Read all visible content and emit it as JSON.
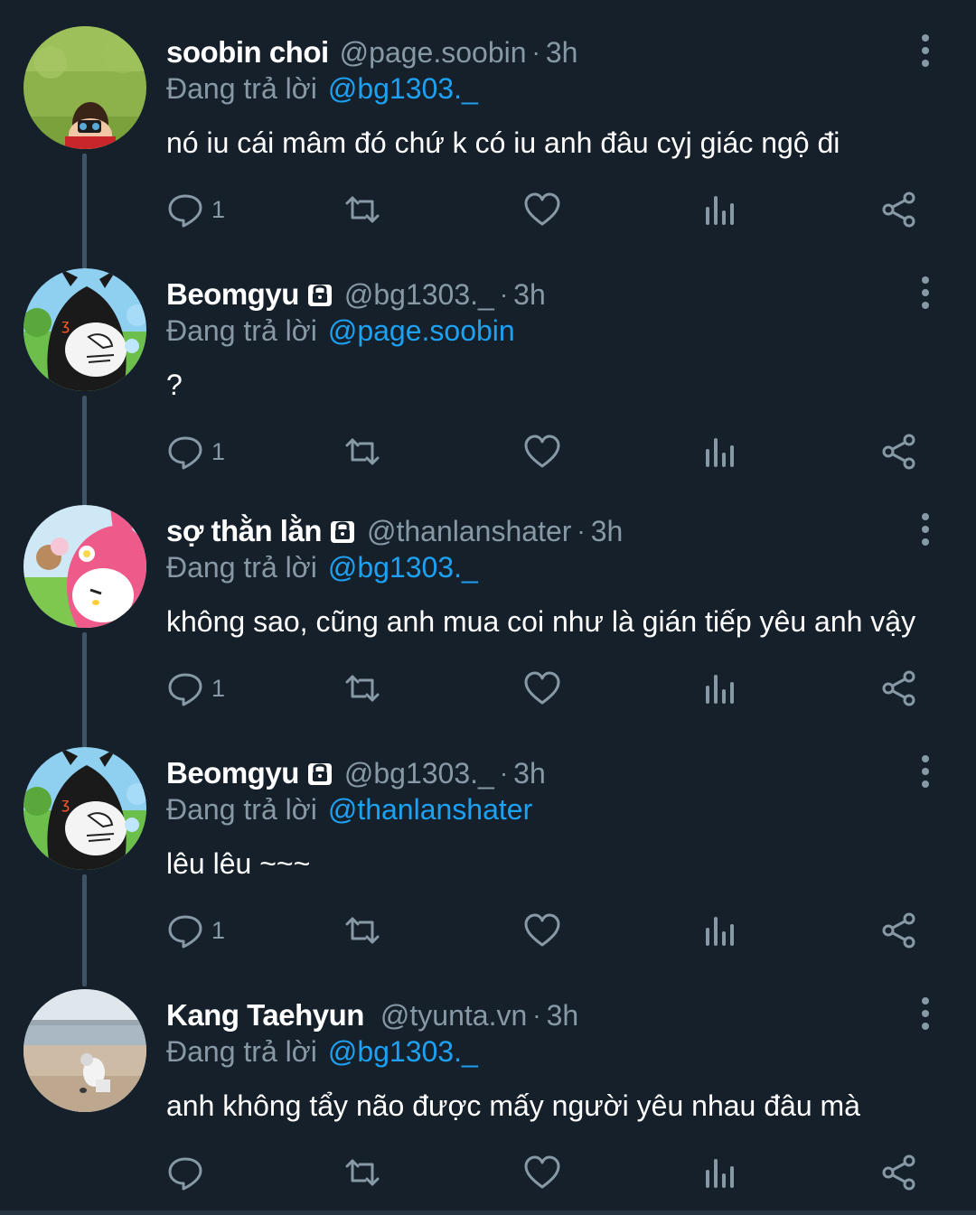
{
  "colors": {
    "background": "#15202b",
    "text": "#ffffff",
    "muted": "#8899a6",
    "link": "#1da1f2",
    "thread_line": "#3d5466"
  },
  "tweets": [
    {
      "name": "soobin choi",
      "locked": false,
      "handle": "@page.soobin",
      "separator": "·",
      "time": "3h",
      "reply_prefix": "Đang trả lời",
      "reply_to": "@bg1303._",
      "text": "nó iu cái mâm đó chứ k có iu anh đâu cyj giác ngộ đi",
      "reply_count": "1",
      "avatar_icon": "photo-avatar-icon"
    },
    {
      "name": "Beomgyu",
      "locked": true,
      "handle": "@bg1303._",
      "separator": "·",
      "time": "3h",
      "reply_prefix": "Đang trả lời",
      "reply_to": "@page.soobin",
      "text": "?",
      "reply_count": "1",
      "avatar_icon": "kuromi-avatar-icon"
    },
    {
      "name": "sợ thằn lằn",
      "locked": true,
      "handle": "@thanlanshater",
      "separator": "·",
      "time": "3h",
      "reply_prefix": "Đang trả lời",
      "reply_to": "@bg1303._",
      "text": "không sao, cũng anh mua coi như là gián tiếp yêu anh vậy",
      "reply_count": "1",
      "avatar_icon": "melody-avatar-icon"
    },
    {
      "name": "Beomgyu",
      "locked": true,
      "handle": "@bg1303._",
      "separator": "·",
      "time": "3h",
      "reply_prefix": "Đang trả lời",
      "reply_to": "@thanlanshater",
      "text": "lêu lêu ~~~",
      "reply_count": "1",
      "avatar_icon": "kuromi-avatar-icon"
    },
    {
      "name": "Kang Taehyun",
      "locked": false,
      "handle": "@tyunta.vn",
      "separator": "·",
      "time": "3h",
      "reply_prefix": "Đang trả lời",
      "reply_to": "@bg1303._",
      "text": "anh không tẩy não được mấy người yêu nhau đâu mà",
      "reply_count": "",
      "avatar_icon": "beach-avatar-icon"
    }
  ]
}
